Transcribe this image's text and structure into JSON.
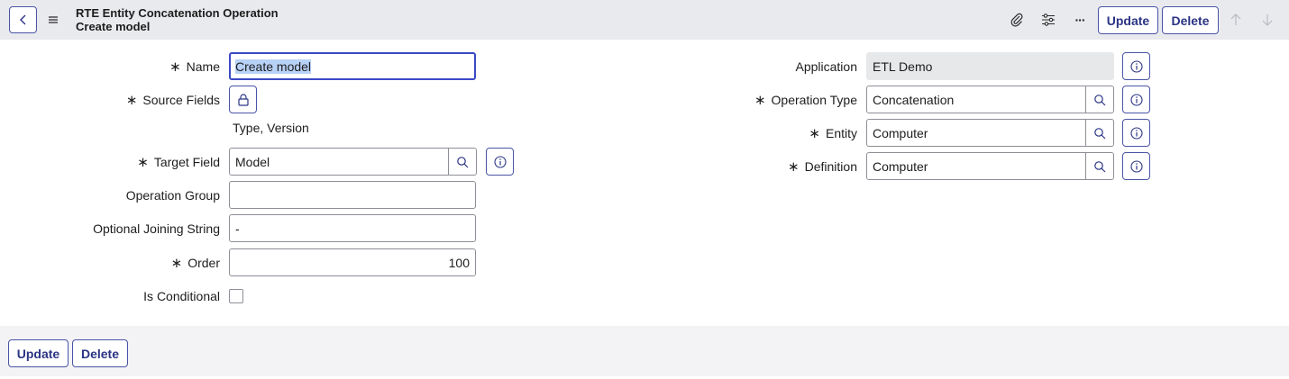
{
  "header": {
    "title_line1": "RTE Entity Concatenation Operation",
    "title_line2": "Create model",
    "update_label": "Update",
    "delete_label": "Delete",
    "more_label": "···"
  },
  "form_left": {
    "name_label": "Name",
    "name_value": "Create model",
    "source_fields_label": "Source Fields",
    "source_fields_value": "Type, Version",
    "target_field_label": "Target Field",
    "target_field_value": "Model",
    "operation_group_label": "Operation Group",
    "operation_group_value": "",
    "joining_string_label": "Optional Joining String",
    "joining_string_value": "-",
    "order_label": "Order",
    "order_value": "100",
    "is_conditional_label": "Is Conditional"
  },
  "form_right": {
    "application_label": "Application",
    "application_value": "ETL Demo",
    "operation_type_label": "Operation Type",
    "operation_type_value": "Concatenation",
    "entity_label": "Entity",
    "entity_value": "Computer",
    "definition_label": "Definition",
    "definition_value": "Computer"
  },
  "footer": {
    "update_label": "Update",
    "delete_label": "Delete"
  },
  "colors": {
    "accent": "#4954a6",
    "header_bg": "#e9eaee",
    "focus": "#3b49c4"
  }
}
